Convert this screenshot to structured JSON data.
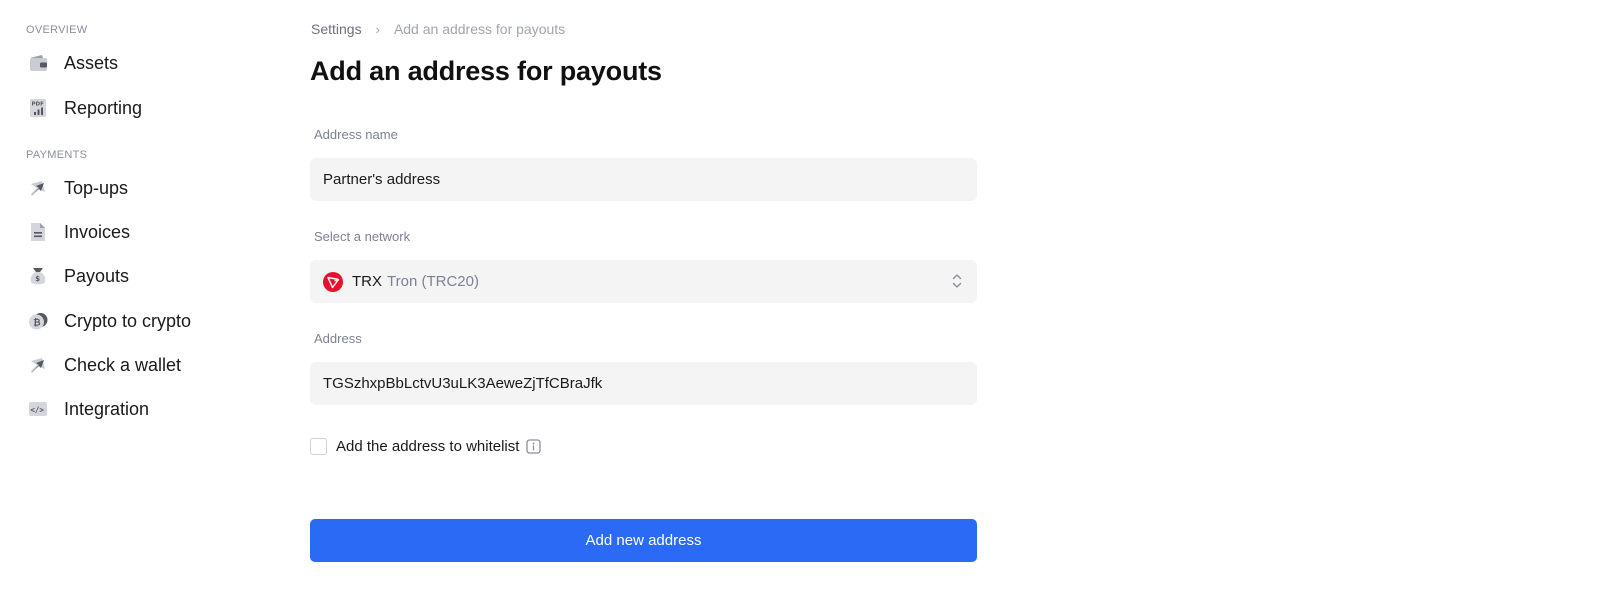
{
  "sidebar": {
    "overview_title": "OVERVIEW",
    "payments_title": "PAYMENTS",
    "overview_items": [
      {
        "label": "Assets",
        "icon": "wallet-icon"
      },
      {
        "label": "Reporting",
        "icon": "pdf-report-icon"
      }
    ],
    "payments_items": [
      {
        "label": "Top-ups",
        "icon": "arrow-in-icon"
      },
      {
        "label": "Invoices",
        "icon": "document-icon"
      },
      {
        "label": "Payouts",
        "icon": "money-bag-icon"
      },
      {
        "label": "Crypto to crypto",
        "icon": "bitcoin-exchange-icon"
      },
      {
        "label": "Check a wallet",
        "icon": "arrow-check-icon"
      },
      {
        "label": "Integration",
        "icon": "code-icon"
      }
    ]
  },
  "breadcrumb": {
    "parent": "Settings",
    "separator": "›",
    "current": "Add an address for payouts"
  },
  "page_title": "Add an address for payouts",
  "form": {
    "address_name_label": "Address name",
    "address_name_value": "Partner's address",
    "network_label": "Select a network",
    "network_code": "TRX",
    "network_name": "Tron (TRC20)",
    "network_icon": "tron-icon",
    "address_label": "Address",
    "address_value": "TGSzhxpBbLctvU3uLK3AeweZjTfCBraJfk",
    "whitelist_label": "Add the address to whitelist",
    "whitelist_checked": false,
    "submit_label": "Add new address"
  },
  "colors": {
    "accent": "#2a6af5",
    "tron_red": "#e8112d",
    "field_bg": "#f4f4f4"
  }
}
